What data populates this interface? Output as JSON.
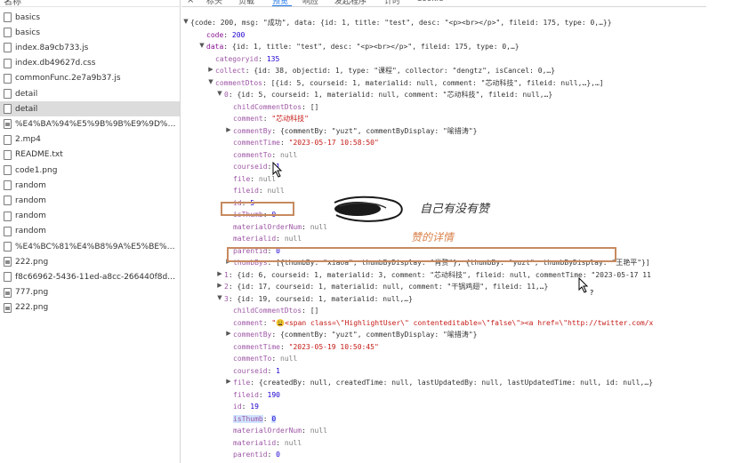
{
  "left_panel": {
    "header": "名称",
    "files": [
      {
        "name": "basics",
        "icon": "document-icon"
      },
      {
        "name": "basics",
        "icon": "document-icon"
      },
      {
        "name": "index.8a9cb733.js",
        "icon": "document-icon"
      },
      {
        "name": "index.db49627d.css",
        "icon": "document-icon"
      },
      {
        "name": "commonFunc.2e7a9b37.js",
        "icon": "document-icon"
      },
      {
        "name": "detail",
        "icon": "document-icon"
      },
      {
        "name": "detail",
        "icon": "document-icon",
        "selected": true
      },
      {
        "name": "%E4%BA%94%E5%9B%9B%E9%9D%92...",
        "icon": "image-icon"
      },
      {
        "name": "2.mp4",
        "icon": "document-icon"
      },
      {
        "name": "README.txt",
        "icon": "document-icon"
      },
      {
        "name": "code1.png",
        "icon": "document-icon"
      },
      {
        "name": "random",
        "icon": "document-icon"
      },
      {
        "name": "random",
        "icon": "document-icon"
      },
      {
        "name": "random",
        "icon": "document-icon"
      },
      {
        "name": "random",
        "icon": "document-icon"
      },
      {
        "name": "%E4%BC%81%E4%B8%9A%E5%BE%AE...",
        "icon": "document-icon"
      },
      {
        "name": "222.png",
        "icon": "image-icon"
      },
      {
        "name": "f8c66962-5436-11ed-a8cc-266440f8d5...",
        "icon": "document-icon"
      },
      {
        "name": "777.png",
        "icon": "image-icon"
      },
      {
        "name": "222.png",
        "icon": "image-icon"
      }
    ]
  },
  "tabs": {
    "close": "×",
    "items": [
      "标头",
      "负载",
      "预览",
      "响应",
      "发起程序",
      "计时",
      "Cookie"
    ],
    "active": "预览"
  },
  "json_lines": [
    {
      "indent": 0,
      "arrow": "▼",
      "parts": [
        [
          "{code: 200, msg: \"成功\", data: {id: 1, title: \"test\", desc: \"<p><br></p>\", fileid: 175, type: 0,…}}",
          "gray"
        ]
      ]
    },
    {
      "indent": 1,
      "parts": [
        [
          "code",
          "key"
        ],
        [
          ": ",
          "gray"
        ],
        [
          "200",
          "num"
        ]
      ]
    },
    {
      "indent": 1,
      "arrow": "▼",
      "parts": [
        [
          "data",
          "key"
        ],
        [
          ": {id: 1, title: \"test\", desc: \"<p><br></p>\", fileid: 175, type: 0,…}",
          "gray"
        ]
      ]
    },
    {
      "indent": 2,
      "parts": [
        [
          "categoryid",
          "key"
        ],
        [
          ": ",
          "gray"
        ],
        [
          "135",
          "num"
        ]
      ]
    },
    {
      "indent": 2,
      "arrow": "▶",
      "parts": [
        [
          "collect",
          "key"
        ],
        [
          ": {id: 38, objectid: 1, type: \"课程\", collector: \"dengtz\", isCancel: 0,…}",
          "gray"
        ]
      ]
    },
    {
      "indent": 2,
      "arrow": "▼",
      "parts": [
        [
          "commentDtos",
          "key"
        ],
        [
          ": [{id: 5, courseid: 1, materialid: null, comment: \"芯动科技\", fileid: null,…},…]",
          "gray"
        ]
      ]
    },
    {
      "indent": 3,
      "arrow": "▼",
      "parts": [
        [
          "0",
          "key"
        ],
        [
          ": {id: 5, courseid: 1, materialid: null, comment: \"芯动科技\", fileid: null,…}",
          "gray"
        ]
      ]
    },
    {
      "indent": 4,
      "parts": [
        [
          "childCommentDtos",
          "key"
        ],
        [
          ": []",
          "gray"
        ]
      ]
    },
    {
      "indent": 4,
      "parts": [
        [
          "comment",
          "key"
        ],
        [
          ": ",
          "gray"
        ],
        [
          "\"芯动科技\"",
          "str"
        ]
      ]
    },
    {
      "indent": 4,
      "arrow": "▶",
      "parts": [
        [
          "commentBy",
          "key"
        ],
        [
          ": {commentBy: \"yuzt\", commentByDisplay: \"喻措涛\"}",
          "gray"
        ]
      ]
    },
    {
      "indent": 4,
      "parts": [
        [
          "commentTime",
          "key"
        ],
        [
          ": ",
          "gray"
        ],
        [
          "\"2023-05-17 10:58:50\"",
          "str"
        ]
      ]
    },
    {
      "indent": 4,
      "parts": [
        [
          "commentTo",
          "key"
        ],
        [
          ": ",
          "gray"
        ],
        [
          "null",
          "null"
        ]
      ]
    },
    {
      "indent": 4,
      "parts": [
        [
          "courseid",
          "key"
        ],
        [
          ": ",
          "gray"
        ],
        [
          "1",
          "num"
        ]
      ]
    },
    {
      "indent": 4,
      "parts": [
        [
          "file",
          "key"
        ],
        [
          ": ",
          "gray"
        ],
        [
          "null",
          "null"
        ]
      ]
    },
    {
      "indent": 4,
      "parts": [
        [
          "fileid",
          "key"
        ],
        [
          ": ",
          "gray"
        ],
        [
          "null",
          "null"
        ]
      ]
    },
    {
      "indent": 4,
      "parts": [
        [
          "id",
          "key"
        ],
        [
          ": ",
          "gray"
        ],
        [
          "5",
          "num"
        ]
      ]
    },
    {
      "indent": 4,
      "parts": [
        [
          "isThumb",
          "key"
        ],
        [
          ": ",
          "gray"
        ],
        [
          "0",
          "num"
        ]
      ]
    },
    {
      "indent": 4,
      "parts": [
        [
          "materialOrderNum",
          "key"
        ],
        [
          ": ",
          "gray"
        ],
        [
          "null",
          "null"
        ]
      ]
    },
    {
      "indent": 4,
      "parts": [
        [
          "materialid",
          "key"
        ],
        [
          ": ",
          "gray"
        ],
        [
          "null",
          "null"
        ]
      ]
    },
    {
      "indent": 4,
      "parts": [
        [
          "parentid",
          "key"
        ],
        [
          ": ",
          "gray"
        ],
        [
          "0",
          "num"
        ]
      ]
    },
    {
      "indent": 4,
      "arrow": "▶",
      "parts": [
        [
          "thumbBys",
          "key"
        ],
        [
          ": [{thumbBy: \"xiaoa\", thumbByDisplay: \"肖赘\"}, {thumbBy: \"yuzt\", thumbByDisplay: \"王艳平\"}]",
          "gray"
        ]
      ]
    },
    {
      "indent": 3,
      "arrow": "▶",
      "parts": [
        [
          "1",
          "key"
        ],
        [
          ": {id: 6, courseid: 1, materialid: 3, comment: \"芯动科技\", fileid: null, commentTime: \"2023-05-17 11",
          "gray"
        ]
      ]
    },
    {
      "indent": 3,
      "arrow": "▶",
      "parts": [
        [
          "2",
          "key"
        ],
        [
          ": {id: 17, courseid: 1, materialid: null, comment: \"干锅鸡翅\", fileid: 11,…}",
          "gray"
        ]
      ]
    },
    {
      "indent": 3,
      "arrow": "▼",
      "parts": [
        [
          "3",
          "key"
        ],
        [
          ": {id: 19, courseid: 1, materialid: null,…}",
          "gray"
        ]
      ]
    },
    {
      "indent": 4,
      "parts": [
        [
          "childCommentDtos",
          "key"
        ],
        [
          ": []",
          "gray"
        ]
      ]
    },
    {
      "indent": 4,
      "parts": [
        [
          "comment",
          "key"
        ],
        [
          ": ",
          "gray"
        ],
        [
          "\"😩<span class=\\\"HighlightUser\\\" contenteditable=\\\"false\\\"><a href=\\\"http://twitter.com/x",
          "str"
        ]
      ]
    },
    {
      "indent": 4,
      "arrow": "▶",
      "parts": [
        [
          "commentBy",
          "key"
        ],
        [
          ": {commentBy: \"yuzt\", commentByDisplay: \"喻措涛\"}",
          "gray"
        ]
      ]
    },
    {
      "indent": 4,
      "parts": [
        [
          "commentTime",
          "key"
        ],
        [
          ": ",
          "gray"
        ],
        [
          "\"2023-05-19 10:50:45\"",
          "str"
        ]
      ]
    },
    {
      "indent": 4,
      "parts": [
        [
          "commentTo",
          "key"
        ],
        [
          ": ",
          "gray"
        ],
        [
          "null",
          "null"
        ]
      ]
    },
    {
      "indent": 4,
      "parts": [
        [
          "courseid",
          "key"
        ],
        [
          ": ",
          "gray"
        ],
        [
          "1",
          "num"
        ]
      ]
    },
    {
      "indent": 4,
      "arrow": "▶",
      "parts": [
        [
          "file",
          "key"
        ],
        [
          ": {createdBy: null, createdTime: null, lastUpdatedBy: null, lastUpdatedTime: null, id: null,…}",
          "gray"
        ]
      ]
    },
    {
      "indent": 4,
      "parts": [
        [
          "fileid",
          "key"
        ],
        [
          ": ",
          "gray"
        ],
        [
          "190",
          "num"
        ]
      ]
    },
    {
      "indent": 4,
      "parts": [
        [
          "id",
          "key"
        ],
        [
          ": ",
          "gray"
        ],
        [
          "19",
          "num"
        ]
      ]
    },
    {
      "indent": 4,
      "parts": [
        [
          "isThumb",
          "key",
          "sel"
        ],
        [
          ": ",
          "gray"
        ],
        [
          "0",
          "num",
          "sel"
        ]
      ]
    },
    {
      "indent": 4,
      "parts": [
        [
          "materialOrderNum",
          "key"
        ],
        [
          ": ",
          "gray"
        ],
        [
          "null",
          "null"
        ]
      ]
    },
    {
      "indent": 4,
      "parts": [
        [
          "materialid",
          "key"
        ],
        [
          ": ",
          "gray"
        ],
        [
          "null",
          "null"
        ]
      ]
    },
    {
      "indent": 4,
      "parts": [
        [
          "parentid",
          "key"
        ],
        [
          ": ",
          "gray"
        ],
        [
          "0",
          "num"
        ]
      ]
    },
    {
      "indent": 4,
      "parts": [
        [
          "thumbBys",
          "key"
        ],
        [
          ": []",
          "gray"
        ]
      ]
    }
  ],
  "annotations": {
    "own_like_label": "自己有没有赞",
    "like_details_label": "赞的详情",
    "label_color": "#333333",
    "detail_color": "#d9824b",
    "box_color": "#c78a60"
  }
}
